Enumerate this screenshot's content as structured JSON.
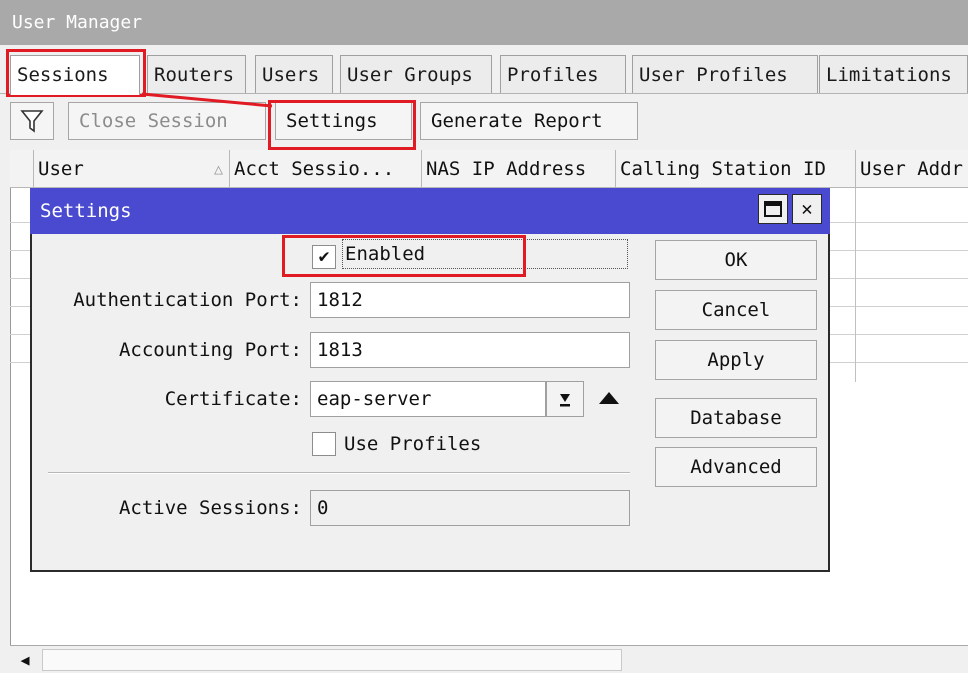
{
  "window": {
    "title": "User Manager"
  },
  "tabs": [
    "Sessions",
    "Routers",
    "Users",
    "User Groups",
    "Profiles",
    "User Profiles",
    "Limitations"
  ],
  "toolbar": {
    "filter_icon": "filter-icon",
    "close_session": "Close Session",
    "settings": "Settings",
    "generate_report": "Generate Report"
  },
  "table": {
    "columns": [
      "User",
      "Acct Sessio...",
      "NAS IP Address",
      "Calling Station ID",
      "User Addr"
    ],
    "sort_indicator": "△"
  },
  "dialog": {
    "title": "Settings",
    "enabled_label": "Enabled",
    "enabled_checked": true,
    "auth_port_label": "Authentication Port:",
    "auth_port_value": "1812",
    "acct_port_label": "Accounting Port:",
    "acct_port_value": "1813",
    "certificate_label": "Certificate:",
    "certificate_value": "eap-server",
    "use_profiles_label": "Use Profiles",
    "use_profiles_checked": false,
    "active_sessions_label": "Active Sessions:",
    "active_sessions_value": "0",
    "buttons": {
      "ok": "OK",
      "cancel": "Cancel",
      "apply": "Apply",
      "database": "Database",
      "advanced": "Advanced"
    }
  },
  "colors": {
    "highlight": "#e01b24",
    "dialog_title": "#4a4ad0",
    "window_title": "#a9a9a9"
  }
}
